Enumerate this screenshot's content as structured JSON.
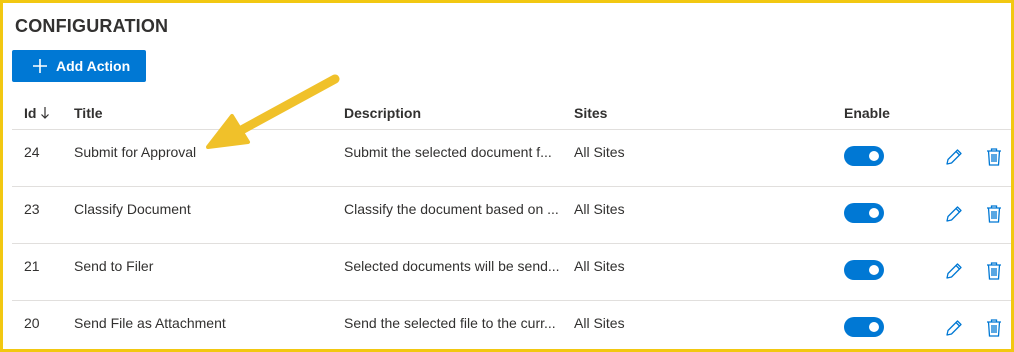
{
  "page": {
    "title": "CONFIGURATION"
  },
  "toolbar": {
    "add_action_label": "Add Action",
    "add_action_icon": "plus-icon"
  },
  "table": {
    "columns": {
      "id": "Id",
      "title": "Title",
      "description": "Description",
      "sites": "Sites",
      "enable": "Enable"
    },
    "sort": {
      "column": "Id",
      "direction": "descending",
      "icon": "arrow-down-icon"
    },
    "rows": [
      {
        "id": "24",
        "title": "Submit for Approval",
        "description": "Submit the selected document f...",
        "sites": "All Sites",
        "enabled": true
      },
      {
        "id": "23",
        "title": "Classify Document",
        "description": "Classify the document based on ...",
        "sites": "All Sites",
        "enabled": true
      },
      {
        "id": "21",
        "title": "Send to Filer",
        "description": "Selected documents will be send...",
        "sites": "All Sites",
        "enabled": true
      },
      {
        "id": "20",
        "title": "Send File as Attachment",
        "description": "Send the selected file to the curr...",
        "sites": "All Sites",
        "enabled": true
      }
    ],
    "row_actions": [
      "edit-icon",
      "delete-icon"
    ]
  },
  "colors": {
    "accent": "#0078d4",
    "highlight_border": "#f2c811",
    "annotation_arrow": "#f0c12a"
  }
}
